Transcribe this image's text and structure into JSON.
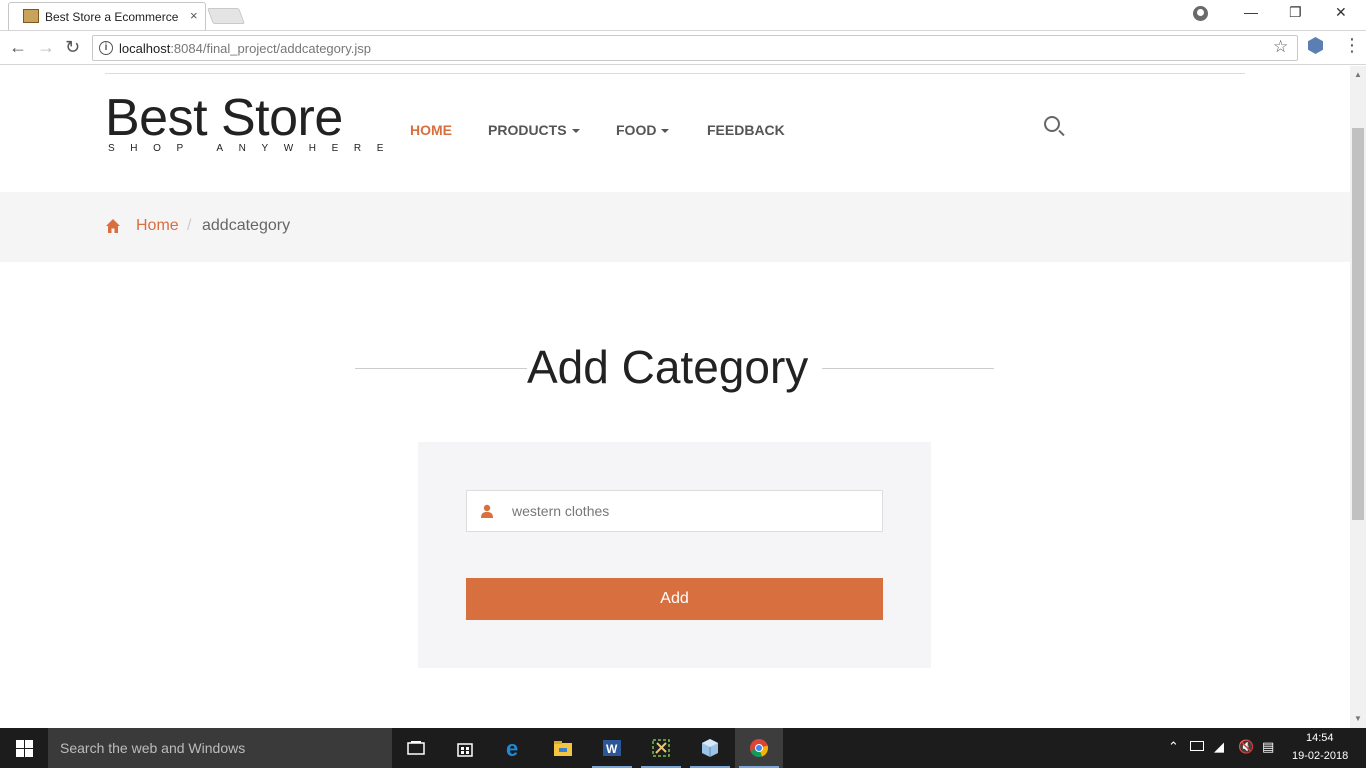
{
  "browser": {
    "tab_title": "Best Store a Ecommerce",
    "tab_close": "×",
    "url_host": "localhost",
    "url_rest": ":8084/final_project/addcategory.jsp",
    "window_controls": {
      "minimize": "—",
      "restore": "❐",
      "close": "✕"
    },
    "nav": {
      "back": "←",
      "forward": "→",
      "reload": "↻"
    },
    "bookmark_star": "☆",
    "menu": "⋮"
  },
  "header": {
    "logo_title": "Best Store",
    "logo_tagline": "SHOP ANYWHERE",
    "nav": {
      "home": "HOME",
      "products": "PRODUCTS",
      "food": "FOOD",
      "feedback": "FEEDBACK"
    }
  },
  "breadcrumb": {
    "home": "Home",
    "separator": "/",
    "current": "addcategory"
  },
  "main": {
    "title": "Add Category",
    "category_input_value": "western clothes",
    "add_button_label": "Add"
  },
  "taskbar": {
    "search_placeholder": "Search the web and Windows",
    "time": "14:54",
    "date": "19-02-2018"
  },
  "colors": {
    "accent": "#d86f3f",
    "panel_bg": "#f5f5f7",
    "breadcrumb_bg": "#f5f5f5"
  }
}
